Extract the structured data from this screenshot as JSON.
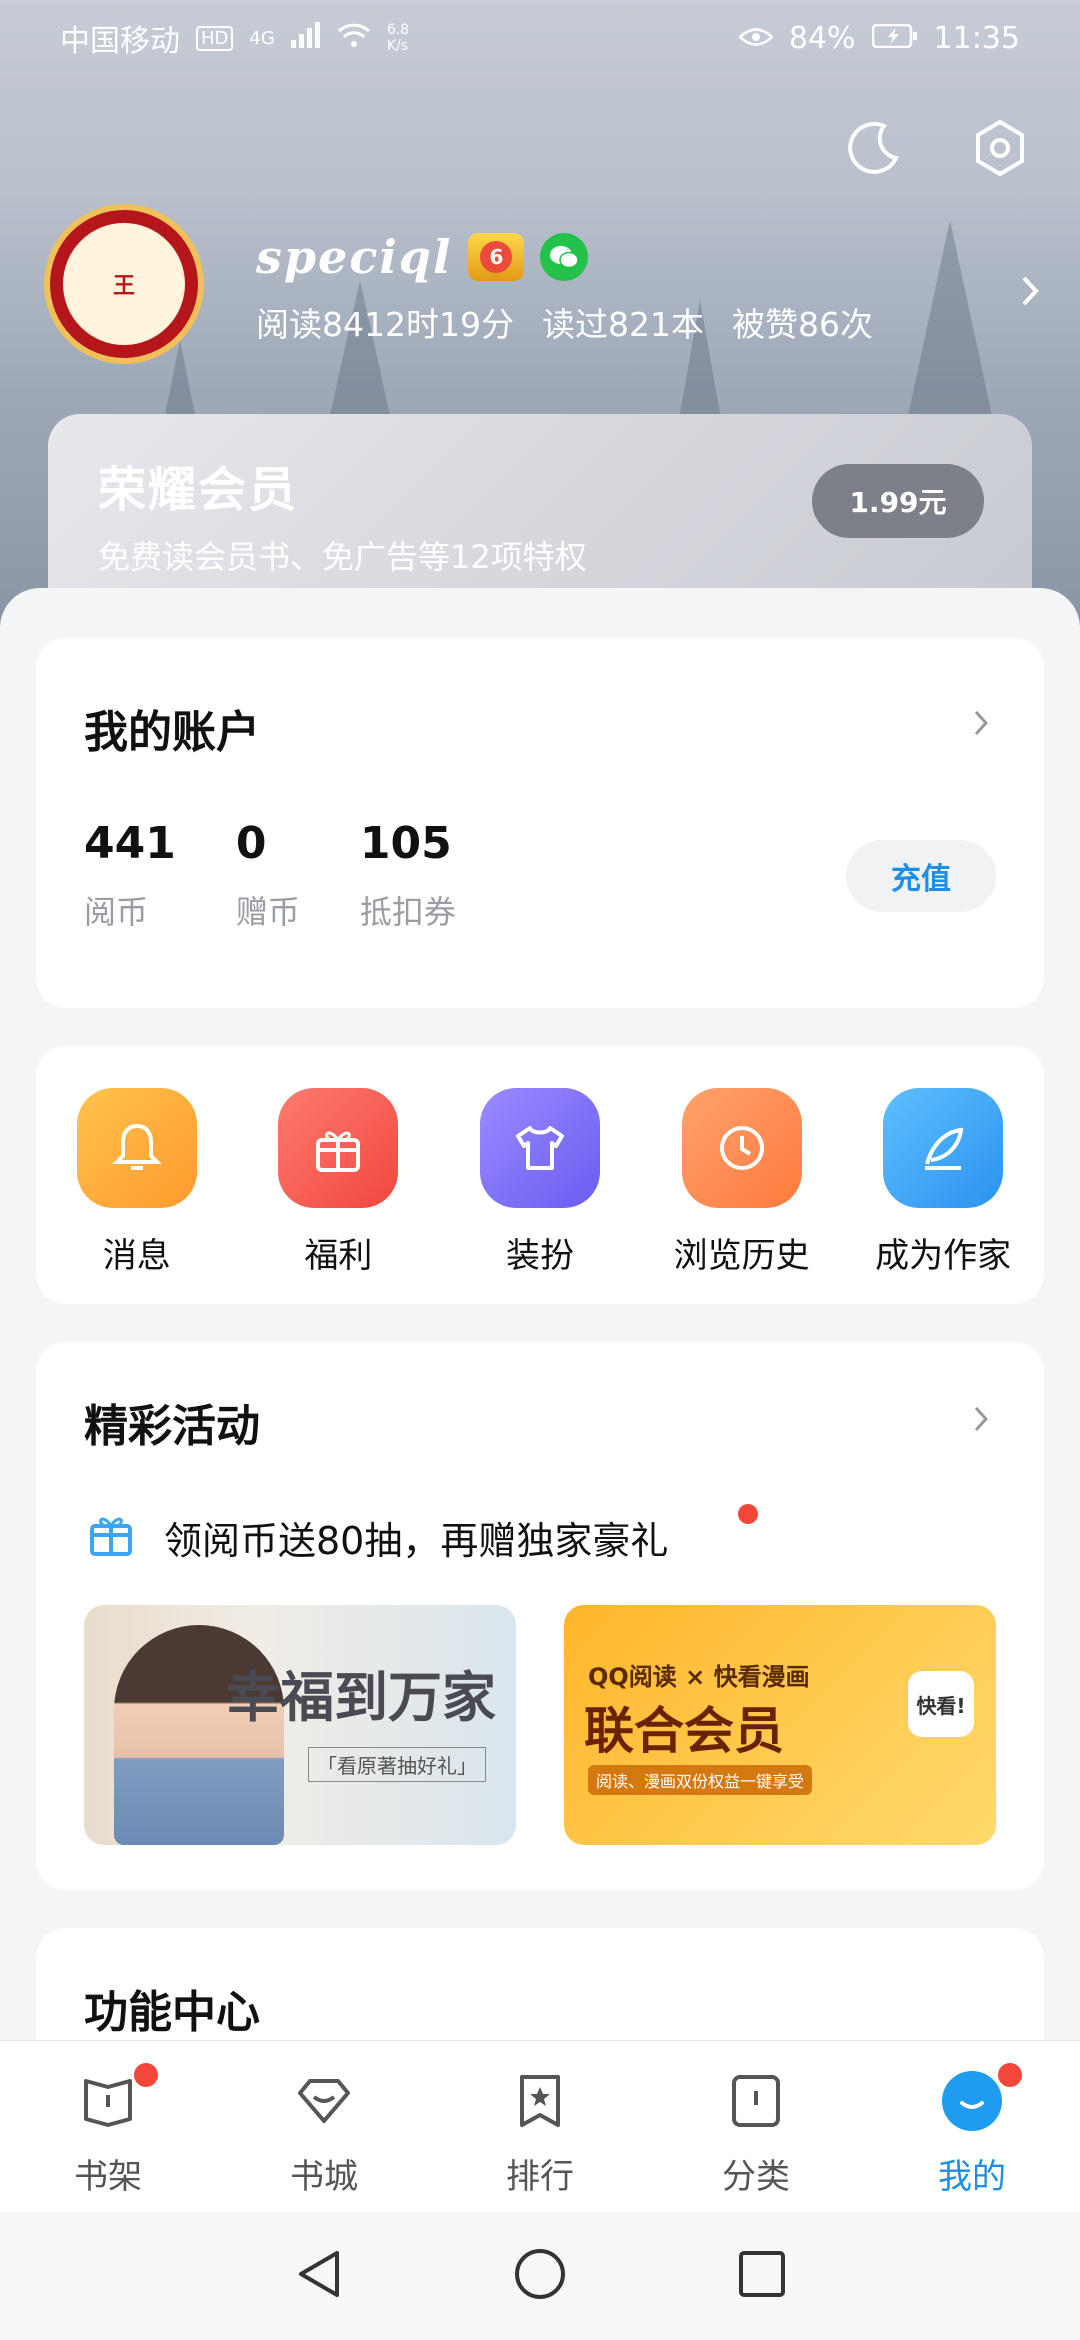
{
  "status_bar": {
    "carrier": "中国移动",
    "hd": "HD",
    "signal": "4G",
    "speed_value": "6.8",
    "speed_unit": "K/s",
    "battery": "84%",
    "time": "11:35"
  },
  "profile": {
    "name": "speciql",
    "level": "6",
    "avatar_text": "王",
    "stats": [
      "阅读8412时19分",
      "读过821本",
      "被赞86次"
    ]
  },
  "vip": {
    "title": "荣耀会员",
    "subtitle": "免费读会员书、免广告等12项特权",
    "price": "1.99元"
  },
  "account": {
    "title": "我的账户",
    "items": [
      {
        "value": "441",
        "label": "阅币"
      },
      {
        "value": "0",
        "label": "赠币"
      },
      {
        "value": "105",
        "label": "抵扣券"
      }
    ],
    "recharge": "充值"
  },
  "quick_actions": [
    {
      "label": "消息",
      "icon": "bell-icon",
      "color": "#ffa83b"
    },
    {
      "label": "福利",
      "icon": "gift-icon",
      "color": "#f4605a"
    },
    {
      "label": "装扮",
      "icon": "tshirt-icon",
      "color": "#7e72f2"
    },
    {
      "label": "浏览历史",
      "icon": "clock-icon",
      "color": "#ff8a4f"
    },
    {
      "label": "成为作家",
      "icon": "feather-icon",
      "color": "#3aa6f5"
    }
  ],
  "activity": {
    "title": "精彩活动",
    "promo": "领阅币送80抽，再赠独家豪礼",
    "banner1": {
      "title": "幸福到万家",
      "sub": "「看原著抽好礼」"
    },
    "banner2": {
      "top": "QQ阅读 × 快看漫画",
      "title": "联合会员",
      "sub": "阅读、漫画双份权益一键享受",
      "icon_text": "快看!"
    }
  },
  "functions": {
    "title": "功能中心"
  },
  "tabbar": [
    {
      "label": "书架",
      "icon": "bookshelf-icon"
    },
    {
      "label": "书城",
      "icon": "bookstore-icon"
    },
    {
      "label": "排行",
      "icon": "ranking-icon"
    },
    {
      "label": "分类",
      "icon": "category-icon"
    },
    {
      "label": "我的",
      "icon": "profile-icon",
      "active": true
    }
  ]
}
